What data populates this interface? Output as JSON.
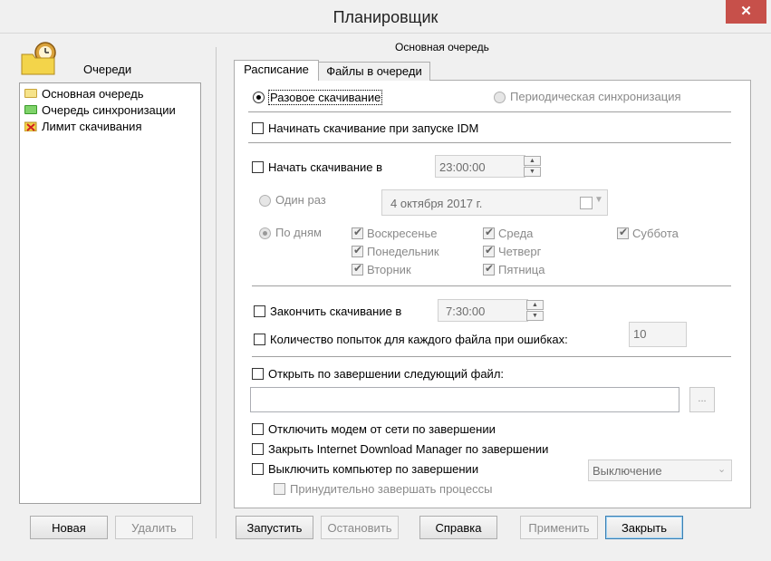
{
  "window": {
    "title": "Планировщик",
    "close_glyph": "✕"
  },
  "left": {
    "heading": "Очереди",
    "queues": [
      {
        "label": "Основная очередь",
        "icon": "queue-folder-icon"
      },
      {
        "label": "Очередь синхронизации",
        "icon": "sync-folder-icon"
      },
      {
        "label": "Лимит скачивания",
        "icon": "limit-icon"
      }
    ],
    "new_label": "Новая",
    "delete_label": "Удалить"
  },
  "right": {
    "heading": "Основная очередь",
    "tabs": [
      "Расписание",
      "Файлы в очереди"
    ],
    "mode_once": "Разовое скачивание",
    "mode_periodic": "Периодическая синхронизация",
    "start_on_launch": "Начинать скачивание при запуске IDM",
    "start_at_label": "Начать скачивание в",
    "start_at_value": "23:00:00",
    "once_label": "Один раз",
    "once_date": "4  октября  2017 г.",
    "daily_label": "По дням",
    "days": [
      "Воскресенье",
      "Понедельник",
      "Вторник",
      "Среда",
      "Четверг",
      "Пятница",
      "Суббота"
    ],
    "stop_at_label": "Закончить скачивание в",
    "stop_at_value": "7:30:00",
    "retries_label": "Количество попыток для каждого файла при ошибках:",
    "retries_value": "10",
    "open_file_label": "Открыть по завершении следующий файл:",
    "open_file_value": "",
    "browse_label": "...",
    "hangup_label": "Отключить модем от сети по завершении",
    "exit_idm_label": "Закрыть Internet Download Manager по завершении",
    "shutdown_label": "Выключить компьютер по завершении",
    "shutdown_option": "Выключение",
    "force_label": "Принудительно завершать процессы"
  },
  "footer": {
    "start": "Запустить",
    "stop": "Остановить",
    "help": "Справка",
    "apply": "Применить",
    "close": "Закрыть"
  }
}
